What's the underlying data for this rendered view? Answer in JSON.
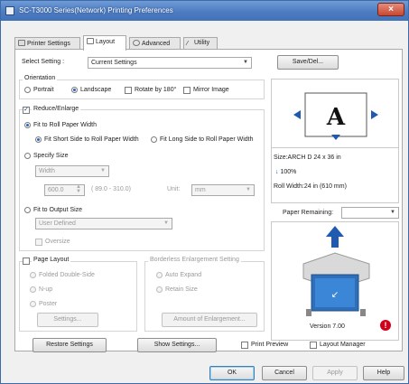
{
  "window": {
    "title": "SC-T3000 Series(Network) Printing Preferences",
    "close_glyph": "×"
  },
  "tabs": [
    {
      "label": "Printer Settings",
      "icon": "printer-icon"
    },
    {
      "label": "Layout",
      "icon": "layout-icon",
      "active": true
    },
    {
      "label": "Advanced",
      "icon": "gear-icon"
    },
    {
      "label": "Utility",
      "icon": "wrench-icon"
    }
  ],
  "select_setting": {
    "label": "Select Setting :",
    "value": "Current Settings",
    "save_button": "Save/Del..."
  },
  "orientation": {
    "label": "Orientation",
    "portrait": "Portrait",
    "landscape": "Landscape",
    "rotate": "Rotate by 180°",
    "mirror": "Mirror Image"
  },
  "reduce_enlarge": {
    "label": "Reduce/Enlarge",
    "fit_roll": "Fit to Roll Paper Width",
    "fit_short": "Fit Short Side to Roll Paper Width",
    "fit_long": "Fit Long Side to Roll Paper Width",
    "specify_size": "Specify Size",
    "width_combo": "Width",
    "size_value": "600.0",
    "size_range": "( 89.0 - 310.0)",
    "unit_label": "Unit:",
    "unit_value": "mm",
    "fit_output": "Fit to Output Size",
    "user_defined": "User Defined",
    "oversize": "Oversize"
  },
  "page_layout": {
    "label": "Page Layout",
    "folded": "Folded Double-Side",
    "nup": "N-up",
    "poster": "Poster",
    "settings_button": "Settings..."
  },
  "borderless": {
    "label": "Borderless Enlargement Setting",
    "auto_expand": "Auto Expand",
    "retain_size": "Retain Size",
    "amount_button": "Amount of Enlargement..."
  },
  "preview": {
    "letter": "A"
  },
  "info": {
    "size": "Size:ARCH D 24 x 36 in",
    "scale": "100%",
    "roll_width": "Roll Width:24 in (610 mm)"
  },
  "paper_remaining": {
    "label": "Paper Remaining:"
  },
  "printer": {
    "version": "Version 7.00"
  },
  "bottom": {
    "restore": "Restore Settings",
    "show_settings": "Show Settings...",
    "print_preview": "Print Preview",
    "layout_manager": "Layout Manager"
  },
  "dialog": {
    "ok": "OK",
    "cancel": "Cancel",
    "apply": "Apply",
    "help": "Help"
  },
  "colors": {
    "title_bar": "#4d7cc1",
    "close_button": "#c8472f",
    "selected_radio": "#2b63c0",
    "paper_roll": "#2f6fb8",
    "warning": "#d0021b"
  }
}
